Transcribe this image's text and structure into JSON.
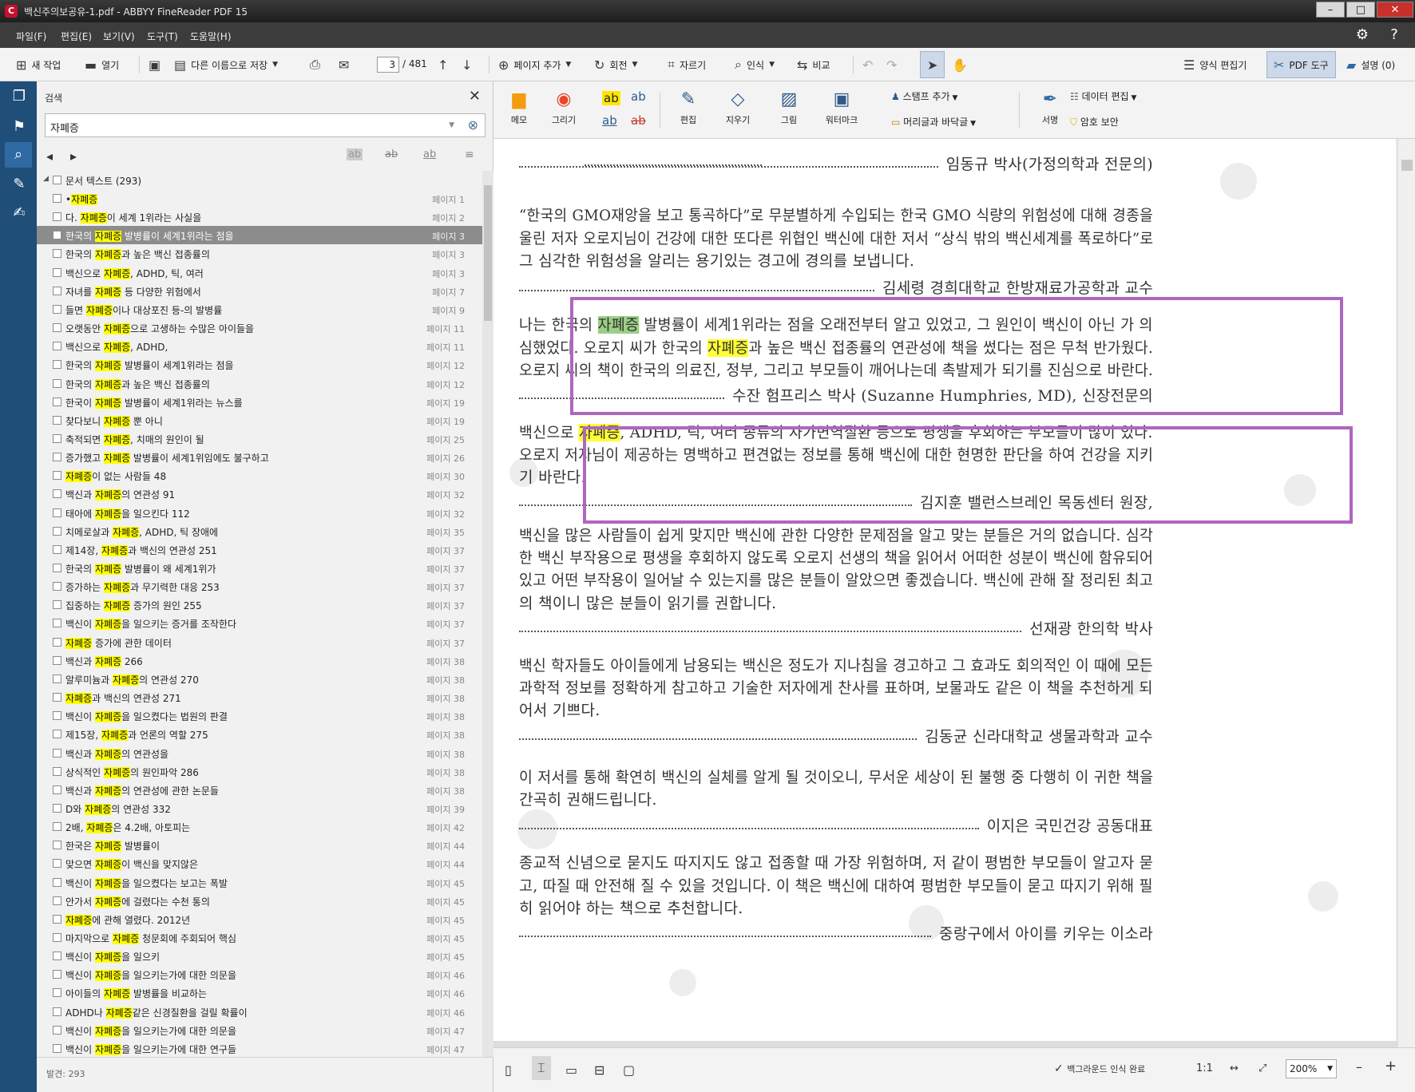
{
  "window": {
    "title": "백신주의보공유-1.pdf - ABBYY FineReader PDF 15",
    "app_icon": "C",
    "controls": [
      "–",
      "□",
      "✕"
    ]
  },
  "menu": [
    "파일(F)",
    "편집(E)",
    "보기(V)",
    "도구(T)",
    "도움말(H)"
  ],
  "toolbar": {
    "new_task": "새 작업",
    "open": "열기",
    "save_as": "다른 이름으로 저장",
    "page_current": "3",
    "page_total": "/ 481",
    "add_page": "페이지 추가",
    "rotate": "회전",
    "crop": "자르기",
    "recognize": "인식",
    "compare": "비교",
    "form_editor": "양식 편집기",
    "pdf_tools": "PDF 도구",
    "comments": "설명 (0)"
  },
  "search": {
    "header": "검색",
    "query": "자폐증",
    "group_label": "문서 텍스트 (293)",
    "found": "발견: 293",
    "results": [
      {
        "pre": "•",
        "hl": "자폐증",
        "post": "",
        "page": "페이지 1"
      },
      {
        "pre": "다. ",
        "hl": "자폐증",
        "post": "이 세계 1위라는 사실을",
        "page": "페이지 2"
      },
      {
        "pre": "한국의 ",
        "hl": "자폐증",
        "post": " 발병률이 세계1위라는 점을",
        "page": "페이지 3",
        "selected": true
      },
      {
        "pre": "한국의 ",
        "hl": "자폐증",
        "post": "과 높은 백신 접종률의",
        "page": "페이지 3"
      },
      {
        "pre": "백신으로 ",
        "hl": "자폐증",
        "post": ", ADHD, 틱, 여러",
        "page": "페이지 3"
      },
      {
        "pre": "자녀를 ",
        "hl": "자폐증",
        "post": " 등 다양한 위험에서",
        "page": "페이지 7"
      },
      {
        "pre": "들면 ",
        "hl": "자폐증",
        "post": "이나 대상포진 등-의 발병률",
        "page": "페이지 9"
      },
      {
        "pre": "오랫동안 ",
        "hl": "자폐증",
        "post": "으로 고생하는 수많은 아이들을",
        "page": "페이지 11"
      },
      {
        "pre": "백신으로 ",
        "hl": "자폐증",
        "post": ", ADHD,",
        "page": "페이지 11"
      },
      {
        "pre": "한국의 ",
        "hl": "자폐증",
        "post": " 발병률이 세계1위라는 점을",
        "page": "페이지 12"
      },
      {
        "pre": "한국의 ",
        "hl": "자폐증",
        "post": "과 높은 백신 접종률의",
        "page": "페이지 12"
      },
      {
        "pre": "한국이 ",
        "hl": "자폐증",
        "post": " 발병률이 세계1위라는 뉴스를",
        "page": "페이지 19"
      },
      {
        "pre": "찾다보니 ",
        "hl": "자폐증",
        "post": " 뿐 아니",
        "page": "페이지 19"
      },
      {
        "pre": "축적되면 ",
        "hl": "자폐증",
        "post": ", 치매의 원인이 될",
        "page": "페이지 25"
      },
      {
        "pre": "증가했고 ",
        "hl": "자폐증",
        "post": " 발병률이 세계1위임에도 불구하고",
        "page": "페이지 26"
      },
      {
        "pre": "",
        "hl": "자폐증",
        "post": "이 없는 사람들 48",
        "page": "페이지 30"
      },
      {
        "pre": "백신과 ",
        "hl": "자폐증",
        "post": "의 연관성 91",
        "page": "페이지 32"
      },
      {
        "pre": "태아에 ",
        "hl": "자폐증",
        "post": "을 일으킨다 112",
        "page": "페이지 32"
      },
      {
        "pre": "치메로살과 ",
        "hl": "자폐증",
        "post": ", ADHD, 틱 장애에",
        "page": "페이지 35"
      },
      {
        "pre": "제14장, ",
        "hl": "자폐증",
        "post": "과 백신의 연관성 251",
        "page": "페이지 37"
      },
      {
        "pre": "한국의 ",
        "hl": "자폐증",
        "post": " 발병률이 왜 세계1위가",
        "page": "페이지 37"
      },
      {
        "pre": "증가하는 ",
        "hl": "자폐증",
        "post": "과 무기력한 대응 253",
        "page": "페이지 37"
      },
      {
        "pre": "집중하는 ",
        "hl": "자폐증",
        "post": " 증가의 원인 255",
        "page": "페이지 37"
      },
      {
        "pre": "백신이 ",
        "hl": "자폐증",
        "post": "을 일으키는 증거를 조작한다",
        "page": "페이지 37"
      },
      {
        "pre": "",
        "hl": "자폐증",
        "post": " 증가에 관한 데이터",
        "page": "페이지 37"
      },
      {
        "pre": "백신과 ",
        "hl": "자폐증",
        "post": " 266",
        "page": "페이지 38"
      },
      {
        "pre": "알루미늄과 ",
        "hl": "자폐증",
        "post": "의 연관성 270",
        "page": "페이지 38"
      },
      {
        "pre": "",
        "hl": "자폐증",
        "post": "과 백신의 연관성 271",
        "page": "페이지 38"
      },
      {
        "pre": "백신이 ",
        "hl": "자폐증",
        "post": "을 일으켰다는 법원의 판결",
        "page": "페이지 38"
      },
      {
        "pre": "제15장, ",
        "hl": "자폐증",
        "post": "과 언론의 역할 275",
        "page": "페이지 38"
      },
      {
        "pre": "백신과 ",
        "hl": "자폐증",
        "post": "의 연관성을",
        "page": "페이지 38"
      },
      {
        "pre": "상식적인 ",
        "hl": "자폐증",
        "post": "의 원인파악 286",
        "page": "페이지 38"
      },
      {
        "pre": "백신과 ",
        "hl": "자폐증",
        "post": "의 연관성에 관한 논문들",
        "page": "페이지 38"
      },
      {
        "pre": "D와 ",
        "hl": "자폐증",
        "post": "의 연관성 332",
        "page": "페이지 39"
      },
      {
        "pre": "2배, ",
        "hl": "자폐증",
        "post": "은 4.2배, 아토피는",
        "page": "페이지 42"
      },
      {
        "pre": "한국은 ",
        "hl": "자폐증",
        "post": " 발병률이",
        "page": "페이지 44"
      },
      {
        "pre": "맞으면 ",
        "hl": "자폐증",
        "post": "이 백신을 맞지않은",
        "page": "페이지 44"
      },
      {
        "pre": "백신이 ",
        "hl": "자폐증",
        "post": "을 일으켰다는 보고는 폭발",
        "page": "페이지 45"
      },
      {
        "pre": "안가서 ",
        "hl": "자폐증",
        "post": "에 걸렸다는 수천 통의",
        "page": "페이지 45"
      },
      {
        "pre": "",
        "hl": "자폐증",
        "post": "에 관해  열렸다. 2012년",
        "page": "페이지 45"
      },
      {
        "pre": "마지막으로 ",
        "hl": "자폐증",
        "post": " 청문회에 주회되어 핵심",
        "page": "페이지 45"
      },
      {
        "pre": "백신이 ",
        "hl": "자폐증",
        "post": "을 일으키",
        "page": "페이지 45"
      },
      {
        "pre": "백신이 ",
        "hl": "자폐증",
        "post": "을 일으키는가에 대한 의문을",
        "page": "페이지 46"
      },
      {
        "pre": "아이들의 ",
        "hl": "자폐증",
        "post": " 발병률을 비교하는",
        "page": "페이지 46"
      },
      {
        "pre": "ADHD나 ",
        "hl": "자폐증",
        "post": "같은 신경질환을 걸릴 확률이",
        "page": "페이지 46"
      },
      {
        "pre": "백신이 ",
        "hl": "자폐증",
        "post": "을 일으키는가에 대한 의문을",
        "page": "페이지 47"
      },
      {
        "pre": "백신이 ",
        "hl": "자폐증",
        "post": "을 일으키는가에 대한 연구들",
        "page": "페이지 47"
      }
    ]
  },
  "pdf_tools": {
    "memo": "메모",
    "draw": "그리기",
    "edit": "편집",
    "erase": "지우기",
    "image": "그림",
    "watermark": "워터마크",
    "add_stamp": "스탬프 추가",
    "header_footer": "머리글과 바닥글",
    "signature": "서명",
    "data_edit": "데이터 편집",
    "password": "암호 보안",
    "ab": "ab"
  },
  "document": {
    "lines": [
      {
        "text": "임동규 박사(가정의학과 전문의)",
        "kind": "sig"
      },
      {
        "text": "“한국의 GMO재앙을 보고 통곡하다”로 무분별하게 수입되는 한국 GMO 식량의 위험성에 대해 경종을"
      },
      {
        "text": "울린 저자 오로지님이 건강에 대한 또다른 위협인 백신에 대한 저서 “상식 밖의 백신세계를 폭로하다”로"
      },
      {
        "text": "그 심각한 위험성을 알리는 용기있는 경고에 경의를 보냅니다."
      },
      {
        "text": "김세령 경희대학교 한방재료가공학과 교수",
        "kind": "sig"
      },
      {
        "pre": "나는 한국의 ",
        "hl": "자폐증",
        "post": " 발병률이 세계1위라는 점을 오래전부터 알고 있었고, 그 원인이 백신이 아닌 가 의",
        "hlcolor": "green"
      },
      {
        "pre": "심했었다. 오로지 씨가 한국의 ",
        "hl": "자폐증",
        "post": "과 높은 백신 접종률의 연관성에 책을 썼다는 점은 무척 반가웠다.",
        "hlcolor": "yellow"
      },
      {
        "text": "오로지 씨의 책이 한국의 의료진, 정부, 그리고 부모들이 깨어나는데 촉발제가 되기를 진심으로 바란다."
      },
      {
        "text": "수잔 험프리스 박사 (Suzanne Humphries, MD), 신장전문의",
        "kind": "sig"
      },
      {
        "pre": "백신으로 ",
        "hl": "자폐증",
        "post": ", ADHD, 틱, 여러 종류의 자가면역질환 등으로 평생을 후회하는 부모들이 많이 있다.",
        "hlcolor": "yellow"
      },
      {
        "text": "오로지 저자님이 제공하는 명백하고 편견없는 정보를 통해 백신에 대한 현명한 판단을 하여 건강을 지키"
      },
      {
        "text": "기 바란다."
      },
      {
        "text": "김지훈 밸런스브레인 목동센터 원장,",
        "kind": "sig"
      },
      {
        "text": "백신을 많은 사람들이 쉽게 맞지만 백신에 관한 다양한 문제점을 알고 맞는 분들은 거의 없습니다. 심각"
      },
      {
        "text": "한 백신 부작용으로 평생을 후회하지 않도록 오로지 선생의 책을 읽어서 어떠한 성분이 백신에 함유되어"
      },
      {
        "text": "있고 어떤 부작용이 일어날 수 있는지를 많은 분들이 알았으면 좋겠습니다. 백신에 관해 잘 정리된 최고"
      },
      {
        "text": "의 책이니 많은 분들이 읽기를 권합니다."
      },
      {
        "text": "선재광 한의학 박사",
        "kind": "sig"
      },
      {
        "text": "백신 학자들도 아이들에게 남용되는 백신은 정도가 지나침을 경고하고 그 효과도 회의적인 이 때에 모든"
      },
      {
        "text": "과학적 정보를 정확하게 참고하고 기술한 저자에게 찬사를 표하며, 보물과도 같은 이 책을 추천하게 되"
      },
      {
        "text": "어서 기쁘다."
      },
      {
        "text": "김동균 신라대학교 생물과학과 교수",
        "kind": "sig"
      },
      {
        "text": "이 저서를 통해 확연히 백신의 실체를 알게 될 것이오니, 무서운 세상이 된 불행 중 다행히 이 귀한 책을"
      },
      {
        "text": "간곡히 권해드립니다."
      },
      {
        "text": "이지은 국민건강 공동대표",
        "kind": "sig"
      },
      {
        "text": "종교적 신념으로 묻지도 따지지도 않고 접종할 때 가장 위험하며, 저 같이 평범한 부모들이 알고자 묻"
      },
      {
        "text": "고, 따질 때 안전해 질 수 있을 것입니다. 이 책은 백신에 대하여 평범한 부모들이 묻고 따지기 위해 필"
      },
      {
        "text": "히 읽어야 하는 책으로 추천합니다."
      },
      {
        "text": "중랑구에서 아이를 키우는 이소라",
        "kind": "sig"
      }
    ]
  },
  "status": {
    "background": "백그라운드 인식 완료",
    "ratio": "1:1",
    "zoom": "200%",
    "minus": "–",
    "plus": "+"
  },
  "colors": {
    "accent": "#1f4e79",
    "highlight": "#ffff00",
    "green_highlight": "#9bcf84",
    "frame": "#b066c0"
  }
}
